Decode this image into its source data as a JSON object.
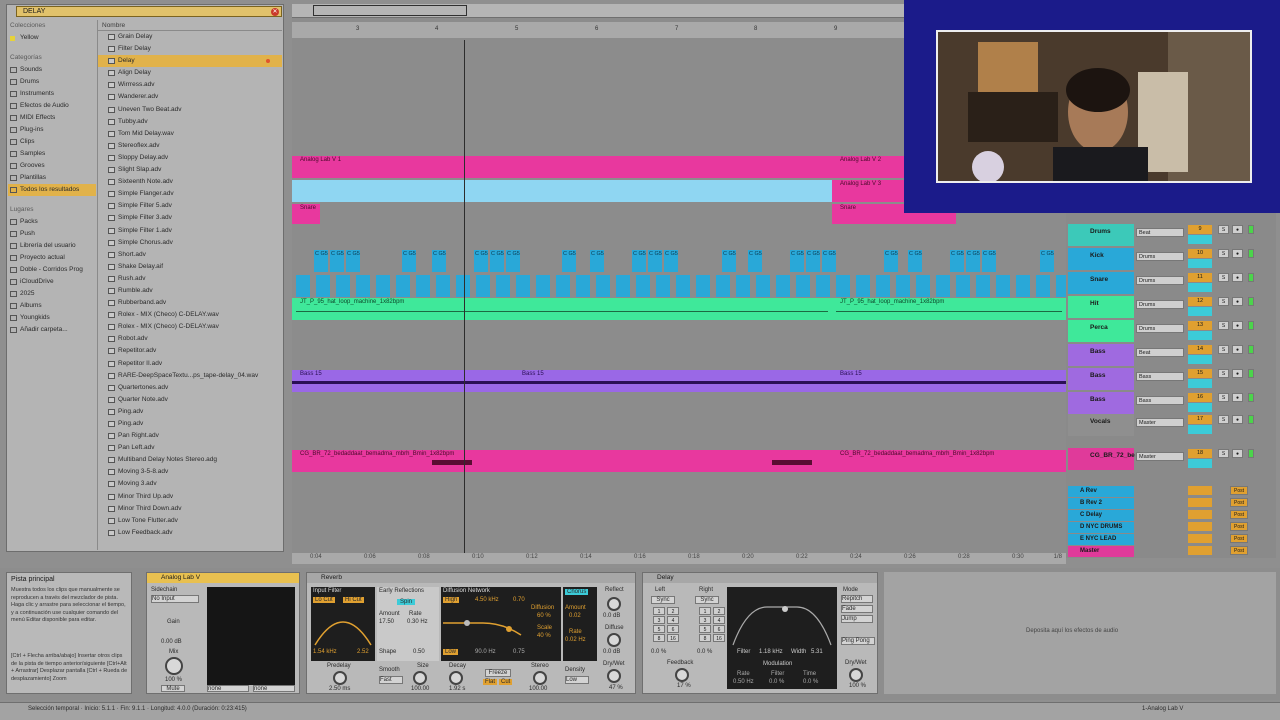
{
  "browser": {
    "search": "DELAY",
    "sections": {
      "colecciones": "Colecciones",
      "categorias": "Categorías",
      "lugares": "Lugares"
    },
    "collections": [
      "Yellow"
    ],
    "categories": [
      "Sounds",
      "Drums",
      "Instruments",
      "Efectos de Audio",
      "MIDI Effects",
      "Plug-ins",
      "Clips",
      "Samples",
      "Grooves",
      "Plantillas",
      "Todos los resultados"
    ],
    "places": [
      "Packs",
      "Push",
      "Librería del usuario",
      "Proyecto actual",
      "Doble - Corridos Prog",
      "iCloudDrive",
      "2025",
      "Albums",
      "Youngkids",
      "Añadir carpeta..."
    ],
    "name_header": "Nombre",
    "files": [
      "Grain Delay",
      "Filter Delay",
      "Delay",
      "Align Delay",
      "Wirrress.adv",
      "Wanderer.adv",
      "Uneven Two Beat.adv",
      "Tubby.adv",
      "Tom Mid Delay.wav",
      "Stereoflex.adv",
      "Sloppy Delay.adv",
      "Slight Slap.adv",
      "Sixteenth Note.adv",
      "Simple Flanger.adv",
      "Simple Filter 5.adv",
      "Simple Filter 3.adv",
      "Simple Filter 1.adv",
      "Simple Chorus.adv",
      "Short.adv",
      "Shake Delay.aif",
      "Rush.adv",
      "Rumble.adv",
      "Rubberband.adv",
      "Rolex - MIX (Checo) C-DELAY.wav",
      "Rolex - MIX (Checo) C-DELAY.wav",
      "Robot.adv",
      "Repetitor.adv",
      "Repetitor II.adv",
      "RARE-DeepSpaceTextu...ps_tape-delay_04.wav",
      "Quartertones.adv",
      "Quarter Note.adv",
      "Ping.adv",
      "Ping.adv",
      "Pan Right.adv",
      "Pan Left.adv",
      "Multiband Delay Notes Stereo.adg",
      "Moving 3-5-8.adv",
      "Moving 3.adv",
      "Minor Third Up.adv",
      "Minor Third Down.adv",
      "Low Tone Flutter.adv",
      "Low Feedback.adv"
    ]
  },
  "ruler": {
    "ticks": [
      "3",
      "4",
      "5",
      "6",
      "7",
      "8",
      "9"
    ]
  },
  "clips": {
    "analog": "Analog Lab V 1",
    "analog2": "Analog Lab V 2",
    "analog3": "Analog Lab V 3",
    "snare": "Snare",
    "snare2": "Snare",
    "loop": "JT_P_95_hat_loop_machine_1x82bpm",
    "loop2": "JT_P_95_hat_loop_machine_1x82bpm",
    "bass1": "Bass 15",
    "bass2": "Bass 15",
    "bass3": "Bass 15",
    "vocal1": "CG_BR_72_bedaddaat_bemadma_mbrh_Bmin_1x82bpm",
    "vocal2": "CG_BR_72_bedaddaat_bemadma_mbrh_Bmin_1x82bpm",
    "beat_label": "C G5"
  },
  "timebar": [
    "0:04",
    "0:06",
    "0:08",
    "0:10",
    "0:12",
    "0:14",
    "0:16",
    "0:18",
    "0:20",
    "0:22",
    "0:24",
    "0:26",
    "0:28",
    "0:30"
  ],
  "timebar_ratio": "1/8",
  "mixer": {
    "tracks": [
      {
        "name": "Drums",
        "io": "Beat",
        "num": "9",
        "color": "#3cc9b9"
      },
      {
        "name": "Kick",
        "io": "Drums",
        "num": "10",
        "color": "#29a8d8"
      },
      {
        "name": "Snare",
        "io": "Drums",
        "num": "11",
        "color": "#29a8d8"
      },
      {
        "name": "Hit",
        "io": "Drums",
        "num": "12",
        "color": "#3fe89a"
      },
      {
        "name": "Perca",
        "io": "Drums",
        "num": "13",
        "color": "#3fe89a"
      },
      {
        "name": "Bass",
        "io": "Beat",
        "num": "14",
        "color": "#9f6ae0"
      },
      {
        "name": "Bass",
        "io": "Bass",
        "num": "15",
        "color": "#9f6ae0"
      },
      {
        "name": "Bass",
        "io": "Bass",
        "num": "16",
        "color": "#9f6ae0"
      },
      {
        "name": "Vocals",
        "io": "Master",
        "num": "17",
        "color": "#8f8f8f"
      },
      {
        "name": "CG_BR_72_be",
        "io": "Master",
        "num": "18",
        "color": "#e03a9a"
      }
    ],
    "returns": [
      {
        "name": "A Rev",
        "color": "#29a8d8"
      },
      {
        "name": "B Rev 2",
        "color": "#29a8d8"
      },
      {
        "name": "C Delay",
        "color": "#29a8d8"
      },
      {
        "name": "D NYC DRUMS",
        "color": "#29a8d8"
      },
      {
        "name": "E NYC LEAD",
        "color": "#29a8d8"
      },
      {
        "name": "Master",
        "color": "#e03a9a"
      }
    ],
    "master_io": "1/2",
    "post": "Post",
    "send_vals": [
      "-inf",
      "-6.2",
      "-11.3",
      "-inf",
      "-inf",
      "-25.0"
    ]
  },
  "info": {
    "title": "Pista principal",
    "body": "Muestra todos los clips que manualmente se reproducen a través del mezclador de pista. Haga clic y arrastre para seleccionar el tiempo, y a continuación use cualquier comando del menú Editar disponible para editar.",
    "shortcuts": "[Ctrl + Flecha arriba/abajo] Insertar otros clips de la pista de tiempo anterior/siguiente [Ctrl+Alt + Arrastrar] Desplazar pantalla [Ctrl + Rueda de desplazamiento] Zoom"
  },
  "devices": {
    "analog": {
      "title": "Analog Lab V",
      "sidechain": "Sidechain",
      "input": "No Input",
      "gain": "Gain",
      "gain_val": "0.00 dB",
      "mix": "Mix",
      "mix_val": "100 %",
      "mute": "Mute",
      "none1": "none",
      "none2": "none"
    },
    "reverb": {
      "title": "Reverb",
      "input_filter": "Input Filter",
      "lo_cut": "Lo Cut",
      "hi_cut": "Hi Cut",
      "freq": "1.54 kHz",
      "width": "2.52",
      "early": "Early Reflections",
      "spin": "Spin",
      "amount": "Amount",
      "rate": "Rate",
      "amount_val": "17.50",
      "rate_val": "0.30 Hz",
      "shape": "Shape",
      "shape_val": "0.50",
      "diffusion": "Diffusion Network",
      "high": "High",
      "high_val": "4.50 kHz",
      "high_amt": "0.70",
      "low": "Low",
      "low_val": "90.0 Hz",
      "low_amt": "0.75",
      "diffusion_lbl": "Diffusion",
      "diffusion_val": "60 %",
      "scale": "Scale",
      "scale_val": "40 %",
      "chorus": "Chorus",
      "ch_amount": "Amount",
      "ch_amount_val": "0.02",
      "ch_rate": "Rate",
      "ch_rate_val": "0.02 Hz",
      "reflect": "Reflect",
      "reflect_val": "0.0 dB",
      "diffuse": "Diffuse",
      "diffuse_val": "0.0 dB",
      "predelay": "Predelay",
      "predelay_val": "2.50 ms",
      "smooth": "Smooth",
      "smooth_val": "Fast",
      "size": "Size",
      "size_val": "100.00",
      "decay": "Decay",
      "decay_val": "1.92 s",
      "freeze": "Freeze",
      "flat": "Flat",
      "cut": "Cut",
      "stereo": "Stereo",
      "stereo_val": "100.00",
      "density": "Density",
      "density_val": "Low",
      "drywet": "Dry/Wet",
      "drywet_val": "47 %"
    },
    "delay": {
      "title": "Delay",
      "left": "Left",
      "right": "Right",
      "sync": "Sync",
      "sync2": "Sync",
      "filter": "Filter",
      "filter_val": "1.18 kHz",
      "width": "Width",
      "width_val": "5.31",
      "modulation": "Modulation",
      "rate": "Rate",
      "rate_val": "0.50 Hz",
      "mfilter": "Filter",
      "mfilter_val": "0.0 %",
      "time": "Time",
      "time_val": "0.0 %",
      "feedback": "Feedback",
      "feedback_val": "17 %",
      "repitch": "Repitch",
      "fade": "Fade",
      "jump": "Jump",
      "pingpong": "Ping Pong",
      "mode": "Mode",
      "drywet": "Dry/Wet",
      "drywet_val": "100 %",
      "left_val": "0.0 %",
      "right_val": "0.0 %",
      "nums": [
        "1",
        "2",
        "3",
        "4",
        "5",
        "6",
        "8",
        "16"
      ]
    },
    "drop_hint": "Deposita aquí los efectos de audio"
  },
  "status": {
    "text": "Selección temporal · Inicio: 5.1.1 · Fin: 9.1.1 · Longitud: 4.0.0 (Duración: 0:23:415)",
    "right": "1-Analog Lab V"
  },
  "colors": {
    "pink": "#e8389e",
    "cyan": "#8fd6f2",
    "blue": "#29a8d8",
    "green": "#3fe89a",
    "purple": "#9a68e6",
    "orange": "#e0a030"
  }
}
